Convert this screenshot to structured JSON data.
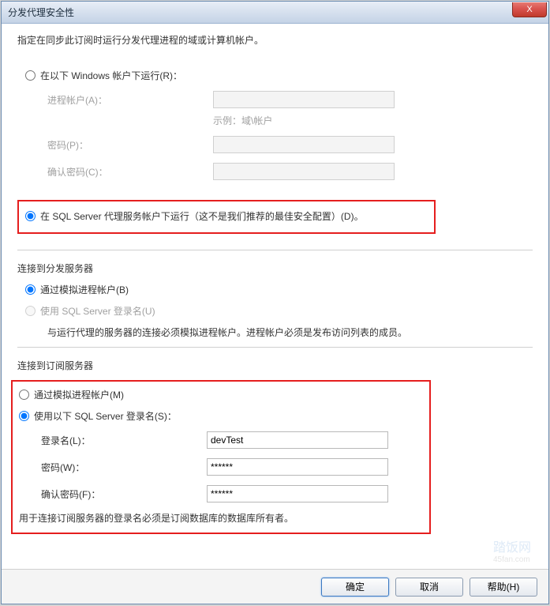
{
  "window": {
    "title": "分发代理安全性",
    "close": "X"
  },
  "description": "指定在同步此订阅时运行分发代理进程的域或计算机帐户。",
  "runAs": {
    "windowsOption": "在以下 Windows 帐户下运行(R)：",
    "processAccountLabel": "进程帐户(A)：",
    "exampleHint": "示例：域\\帐户",
    "passwordLabel": "密码(P)：",
    "confirmPasswordLabel": "确认密码(C)：",
    "sqlAgentOption": "在 SQL Server 代理服务帐户下运行（这不是我们推荐的最佳安全配置）(D)。"
  },
  "connectDistributor": {
    "title": "连接到分发服务器",
    "impersonateOption": "通过模拟进程帐户(B)",
    "sqlLoginOption": "使用 SQL Server 登录名(U)",
    "note": "与运行代理的服务器的连接必须模拟进程帐户。进程帐户必须是发布访问列表的成员。"
  },
  "connectSubscriber": {
    "title": "连接到订阅服务器",
    "impersonateOption": "通过模拟进程帐户(M)",
    "sqlLoginOption": "使用以下 SQL Server 登录名(S)：",
    "loginLabel": "登录名(L)：",
    "loginValue": "devTest",
    "passwordLabel": "密码(W)：",
    "passwordValue": "******",
    "confirmPasswordLabel": "确认密码(F)：",
    "confirmPasswordValue": "******",
    "note": "用于连接订阅服务器的登录名必须是订阅数据库的数据库所有者。"
  },
  "buttons": {
    "ok": "确定",
    "cancel": "取消",
    "help": "帮助(H)"
  },
  "watermark": {
    "text": "踏饭网",
    "url": "45fan.com"
  }
}
